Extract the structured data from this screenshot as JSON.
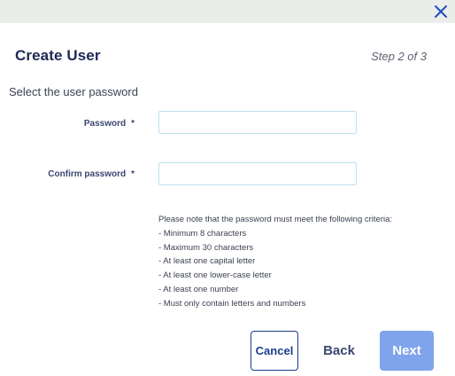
{
  "header": {
    "title": "Create User",
    "step": "Step 2 of 3"
  },
  "form": {
    "subtitle": "Select the user password",
    "password": {
      "label": "Password",
      "required_mark": "*",
      "value": "",
      "placeholder": ""
    },
    "confirm_password": {
      "label": "Confirm password",
      "required_mark": "*",
      "value": "",
      "placeholder": ""
    },
    "criteria": {
      "intro": "Please note that the password must meet the following criteria:",
      "items": [
        "- Minimum 8 characters",
        "- Maximum 30 characters",
        "- At least one capital letter",
        "- At least one lower-case letter",
        "- At least one number",
        "- Must only contain letters and numbers"
      ]
    }
  },
  "footer": {
    "cancel_label": "Cancel",
    "back_label": "Back",
    "next_label": "Next"
  },
  "icons": {
    "close": "close-icon"
  },
  "colors": {
    "title": "#1c2a55",
    "topbar": "#ebedeb",
    "input_border": "#bfe1f2",
    "cancel_border": "#1c3c8c",
    "next_disabled_bg": "#7fa4eb",
    "close_icon": "#1f4fbf"
  }
}
